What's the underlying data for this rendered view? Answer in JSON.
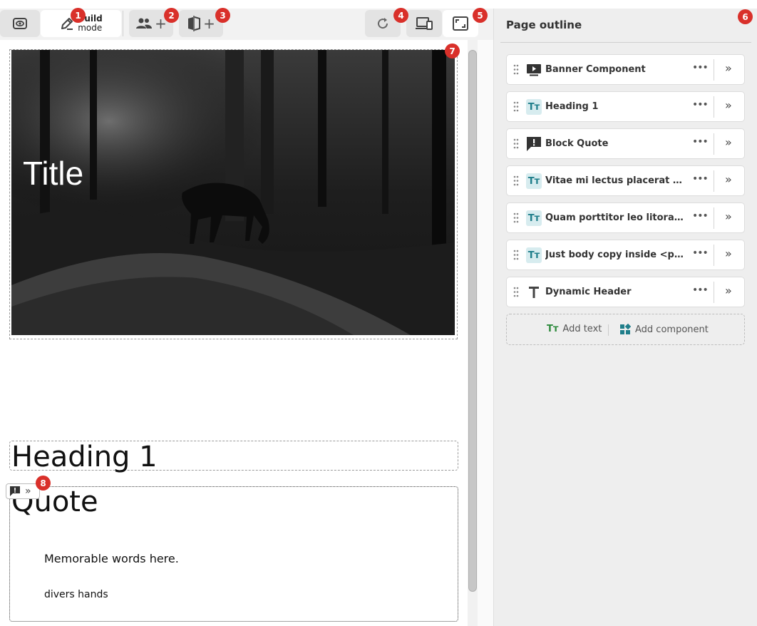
{
  "toolbar": {
    "build_mode_bold": "Build",
    "build_mode_sub": "mode",
    "plus": "+"
  },
  "badges": [
    "1",
    "2",
    "3",
    "4",
    "5",
    "6",
    "7",
    "8"
  ],
  "canvas": {
    "banner_title": "Title",
    "heading": "Heading 1",
    "quote_title": "Quote",
    "quote_words": "Memorable words here.",
    "quote_cite": "divers hands"
  },
  "outline": {
    "title": "Page outline",
    "items": [
      {
        "label": "Banner Component",
        "icon": "banner-icon"
      },
      {
        "label": "Heading 1",
        "icon": "text-icon"
      },
      {
        "label": "Block Quote",
        "icon": "quote-icon"
      },
      {
        "label": "Vitae mi lectus placerat erat l...",
        "icon": "text-icon"
      },
      {
        "label": "Quam porttitor leo litora clas...",
        "icon": "text-icon"
      },
      {
        "label": "Just body copy inside <p></p>...",
        "icon": "text-icon"
      },
      {
        "label": "Dynamic Header",
        "icon": "header-icon"
      }
    ],
    "add_text": "Add text",
    "add_component": "Add component"
  },
  "colors": {
    "badge": "#d9302a",
    "text_icon_bg": "#d7ecef",
    "text_icon_fg": "#1f7e8a",
    "add_text_green": "#2e8b3d"
  }
}
